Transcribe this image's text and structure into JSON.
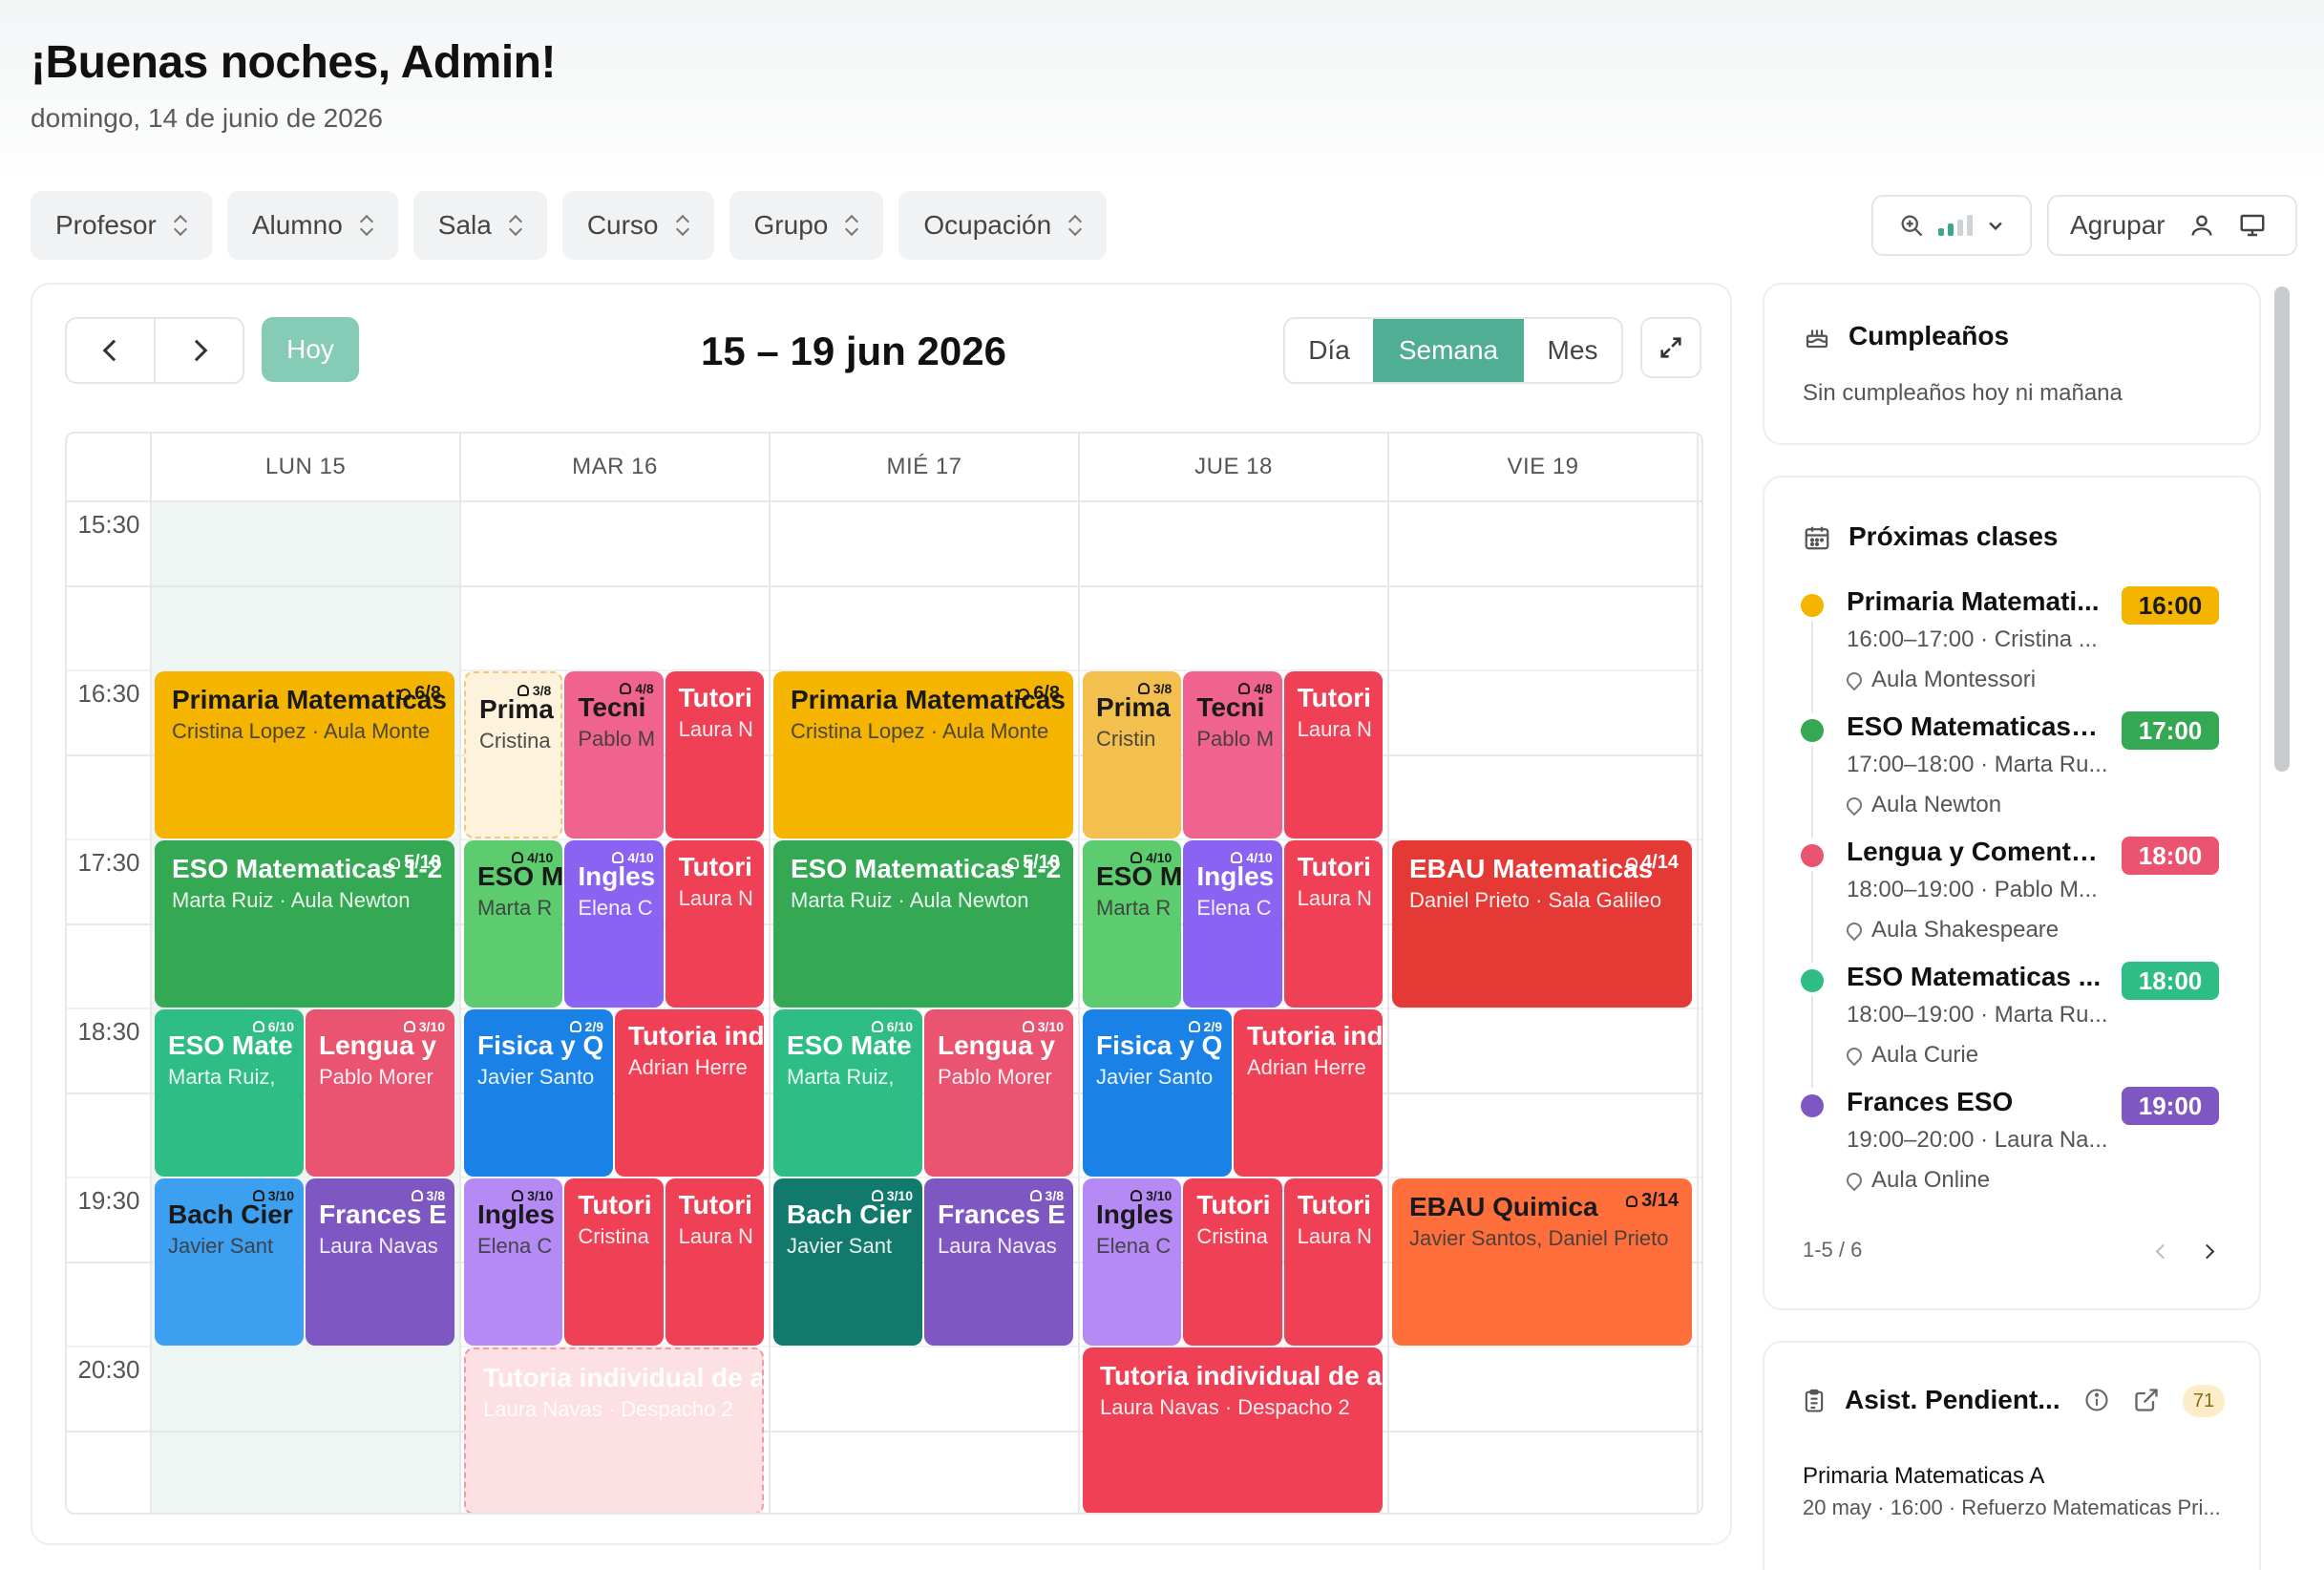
{
  "header": {
    "greeting": "¡Buenas noches, Admin!",
    "date": "domingo, 14 de junio de 2026"
  },
  "filters": [
    "Profesor",
    "Alumno",
    "Sala",
    "Curso",
    "Grupo",
    "Ocupación"
  ],
  "toolbar": {
    "group_label": "Agrupar",
    "zoom_icon": "zoom-in-icon"
  },
  "calendar": {
    "today_label": "Hoy",
    "range_title": "15 – 19 jun 2026",
    "views": [
      "Día",
      "Semana",
      "Mes"
    ],
    "active_view": "Semana",
    "days": [
      "LUN 15",
      "MAR 16",
      "MIÉ 17",
      "JUE 18",
      "VIE 19"
    ],
    "times": [
      "15:30",
      "16:30",
      "17:30",
      "18:30",
      "19:30",
      "20:30"
    ],
    "colors": {
      "amber": "#f4b400",
      "green": "#34a853",
      "teal": "#2fbd86",
      "rose": "#ea5470",
      "blue": "#3d9ff0",
      "purple": "#7e57c2",
      "red": "#ef4056",
      "pink": "#f0638f",
      "lightgreen": "#5ccc6e",
      "violet": "#8b63f2",
      "royal": "#1a82e6",
      "darkteal": "#127a6d",
      "lavender": "#b58af5",
      "crimson": "#e53935",
      "orange": "#ff6f3c"
    },
    "events": [
      {
        "day": 0,
        "start": 16.0,
        "end": 17.0,
        "col": 0,
        "cols": 1,
        "title": "Primaria Matematicas",
        "sub": "Cristina Lopez · Aula Monte",
        "badge": "6/8",
        "color": "amber",
        "dark": true
      },
      {
        "day": 0,
        "start": 17.0,
        "end": 18.0,
        "col": 0,
        "cols": 1,
        "title": "ESO Matematicas 1-2",
        "sub": "Marta Ruiz · Aula Newton",
        "badge": "5/10",
        "color": "green"
      },
      {
        "day": 0,
        "start": 18.0,
        "end": 19.0,
        "col": 0,
        "cols": 2,
        "title": "ESO Mate",
        "sub": "Marta Ruiz,",
        "badge": "6/10",
        "color": "teal",
        "narrow": true
      },
      {
        "day": 0,
        "start": 18.0,
        "end": 19.0,
        "col": 1,
        "cols": 2,
        "title": "Lengua y",
        "sub": "Pablo Morer",
        "badge": "3/10",
        "color": "rose",
        "narrow": true
      },
      {
        "day": 0,
        "start": 19.0,
        "end": 20.0,
        "col": 0,
        "cols": 2,
        "title": "Bach Cier",
        "sub": "Javier Sant",
        "badge": "3/10",
        "color": "blue",
        "narrow": true,
        "dark": true
      },
      {
        "day": 0,
        "start": 19.0,
        "end": 20.0,
        "col": 1,
        "cols": 2,
        "title": "Frances E",
        "sub": "Laura Navas",
        "badge": "3/8",
        "color": "purple",
        "narrow": true
      },
      {
        "day": 1,
        "start": 16.0,
        "end": 17.0,
        "col": 0,
        "cols": 3,
        "title": "Prima",
        "sub": "Cristina",
        "badge": "3/8",
        "color": "cream",
        "narrow": true,
        "dark": true,
        "ghost_amber": true
      },
      {
        "day": 1,
        "start": 16.0,
        "end": 17.0,
        "col": 1,
        "cols": 3,
        "title": "Tecni",
        "sub": "Pablo M",
        "badge": "4/8",
        "color": "pink",
        "narrow": true,
        "dark": true
      },
      {
        "day": 1,
        "start": 16.0,
        "end": 17.0,
        "col": 2,
        "cols": 3,
        "title": "Tutori",
        "sub": "Laura N",
        "badge": "",
        "color": "red",
        "narrow": true
      },
      {
        "day": 1,
        "start": 17.0,
        "end": 18.0,
        "col": 0,
        "cols": 3,
        "title": "ESO M",
        "sub": "Marta R",
        "badge": "4/10",
        "color": "lightgreen",
        "narrow": true,
        "dark": true
      },
      {
        "day": 1,
        "start": 17.0,
        "end": 18.0,
        "col": 1,
        "cols": 3,
        "title": "Ingles",
        "sub": "Elena C",
        "badge": "4/10",
        "color": "violet",
        "narrow": true
      },
      {
        "day": 1,
        "start": 17.0,
        "end": 18.0,
        "col": 2,
        "cols": 3,
        "title": "Tutori",
        "sub": "Laura N",
        "badge": "",
        "color": "red",
        "narrow": true
      },
      {
        "day": 1,
        "start": 18.0,
        "end": 19.0,
        "col": 0,
        "cols": 2,
        "title": "Fisica y Q",
        "sub": "Javier Santo",
        "badge": "2/9",
        "color": "royal",
        "narrow": true
      },
      {
        "day": 1,
        "start": 18.0,
        "end": 19.0,
        "col": 1,
        "cols": 2,
        "title": "Tutoria ind",
        "sub": "Adrian Herre",
        "badge": "",
        "color": "red",
        "narrow": true
      },
      {
        "day": 1,
        "start": 19.0,
        "end": 20.0,
        "col": 0,
        "cols": 3,
        "title": "Ingles",
        "sub": "Elena C",
        "badge": "3/10",
        "color": "lavender",
        "narrow": true,
        "dark": true
      },
      {
        "day": 1,
        "start": 19.0,
        "end": 20.0,
        "col": 1,
        "cols": 3,
        "title": "Tutori",
        "sub": "Cristina",
        "badge": "",
        "color": "red",
        "narrow": true
      },
      {
        "day": 1,
        "start": 19.0,
        "end": 20.0,
        "col": 2,
        "cols": 3,
        "title": "Tutori",
        "sub": "Laura N",
        "badge": "",
        "color": "red",
        "narrow": true
      },
      {
        "day": 1,
        "start": 20.0,
        "end": 21.0,
        "col": 0,
        "cols": 1,
        "title": "Tutoria individual de ap",
        "sub": "Laura Navas · Despacho 2",
        "badge": "",
        "color": "ghostred",
        "ghost": true
      },
      {
        "day": 2,
        "start": 16.0,
        "end": 17.0,
        "col": 0,
        "cols": 1,
        "title": "Primaria Matematicas",
        "sub": "Cristina Lopez · Aula Monte",
        "badge": "6/8",
        "color": "amber",
        "dark": true
      },
      {
        "day": 2,
        "start": 17.0,
        "end": 18.0,
        "col": 0,
        "cols": 1,
        "title": "ESO Matematicas 1-2",
        "sub": "Marta Ruiz · Aula Newton",
        "badge": "5/10",
        "color": "green"
      },
      {
        "day": 2,
        "start": 18.0,
        "end": 19.0,
        "col": 0,
        "cols": 2,
        "title": "ESO Mate",
        "sub": "Marta Ruiz,",
        "badge": "6/10",
        "color": "teal",
        "narrow": true
      },
      {
        "day": 2,
        "start": 18.0,
        "end": 19.0,
        "col": 1,
        "cols": 2,
        "title": "Lengua y",
        "sub": "Pablo Morer",
        "badge": "3/10",
        "color": "rose",
        "narrow": true
      },
      {
        "day": 2,
        "start": 19.0,
        "end": 20.0,
        "col": 0,
        "cols": 2,
        "title": "Bach Cier",
        "sub": "Javier Sant",
        "badge": "3/10",
        "color": "darkteal",
        "narrow": true
      },
      {
        "day": 2,
        "start": 19.0,
        "end": 20.0,
        "col": 1,
        "cols": 2,
        "title": "Frances E",
        "sub": "Laura Navas",
        "badge": "3/8",
        "color": "purple",
        "narrow": true
      },
      {
        "day": 3,
        "start": 16.0,
        "end": 17.0,
        "col": 0,
        "cols": 3,
        "title": "Prima",
        "sub": "Cristin",
        "badge": "3/8",
        "color": "gold",
        "narrow": true,
        "dark": true
      },
      {
        "day": 3,
        "start": 16.0,
        "end": 17.0,
        "col": 1,
        "cols": 3,
        "title": "Tecni",
        "sub": "Pablo M",
        "badge": "4/8",
        "color": "pink",
        "narrow": true,
        "dark": true
      },
      {
        "day": 3,
        "start": 16.0,
        "end": 17.0,
        "col": 2,
        "cols": 3,
        "title": "Tutori",
        "sub": "Laura N",
        "badge": "",
        "color": "red",
        "narrow": true
      },
      {
        "day": 3,
        "start": 17.0,
        "end": 18.0,
        "col": 0,
        "cols": 3,
        "title": "ESO M",
        "sub": "Marta R",
        "badge": "4/10",
        "color": "lightgreen",
        "narrow": true,
        "dark": true
      },
      {
        "day": 3,
        "start": 17.0,
        "end": 18.0,
        "col": 1,
        "cols": 3,
        "title": "Ingles",
        "sub": "Elena C",
        "badge": "4/10",
        "color": "violet",
        "narrow": true
      },
      {
        "day": 3,
        "start": 17.0,
        "end": 18.0,
        "col": 2,
        "cols": 3,
        "title": "Tutori",
        "sub": "Laura N",
        "badge": "",
        "color": "red",
        "narrow": true
      },
      {
        "day": 3,
        "start": 18.0,
        "end": 19.0,
        "col": 0,
        "cols": 2,
        "title": "Fisica y Q",
        "sub": "Javier Santo",
        "badge": "2/9",
        "color": "royal",
        "narrow": true
      },
      {
        "day": 3,
        "start": 18.0,
        "end": 19.0,
        "col": 1,
        "cols": 2,
        "title": "Tutoria ind",
        "sub": "Adrian Herre",
        "badge": "",
        "color": "red",
        "narrow": true
      },
      {
        "day": 3,
        "start": 19.0,
        "end": 20.0,
        "col": 0,
        "cols": 3,
        "title": "Ingles",
        "sub": "Elena C",
        "badge": "3/10",
        "color": "lavender",
        "narrow": true,
        "dark": true
      },
      {
        "day": 3,
        "start": 19.0,
        "end": 20.0,
        "col": 1,
        "cols": 3,
        "title": "Tutori",
        "sub": "Cristina",
        "badge": "",
        "color": "red",
        "narrow": true
      },
      {
        "day": 3,
        "start": 19.0,
        "end": 20.0,
        "col": 2,
        "cols": 3,
        "title": "Tutori",
        "sub": "Laura N",
        "badge": "",
        "color": "red",
        "narrow": true
      },
      {
        "day": 3,
        "start": 20.0,
        "end": 21.0,
        "col": 0,
        "cols": 1,
        "title": "Tutoria individual de ap",
        "sub": "Laura Navas · Despacho 2",
        "badge": "",
        "color": "red"
      },
      {
        "day": 4,
        "start": 17.0,
        "end": 18.0,
        "col": 0,
        "cols": 1,
        "title": "EBAU Matematicas",
        "sub": "Daniel Prieto · Sala Galileo",
        "badge": "4/14",
        "color": "crimson"
      },
      {
        "day": 4,
        "start": 19.0,
        "end": 20.0,
        "col": 0,
        "cols": 1,
        "title": "EBAU Quimica",
        "sub": "Javier Santos, Daniel Prieto",
        "badge": "3/14",
        "color": "orange",
        "dark": true
      }
    ]
  },
  "sidebar": {
    "birthdays": {
      "title": "Cumpleaños",
      "empty": "Sin cumpleaños hoy ni mañana"
    },
    "upcoming": {
      "title": "Próximas clases",
      "items": [
        {
          "name": "Primaria Matemati...",
          "when": "16:00–17:00 · Cristina ...",
          "room": "Aula Montessori",
          "time": "16:00",
          "color": "#f4b400",
          "text": "#1a1a1a"
        },
        {
          "name": "ESO Matematicas 1...",
          "when": "17:00–18:00 · Marta Ru...",
          "room": "Aula Newton",
          "time": "17:00",
          "color": "#34a853",
          "text": "#ffffff"
        },
        {
          "name": "Lengua y Comenta...",
          "when": "18:00–19:00 · Pablo M...",
          "room": "Aula Shakespeare",
          "time": "18:00",
          "color": "#ea5470",
          "text": "#ffffff"
        },
        {
          "name": "ESO Matematicas ...",
          "when": "18:00–19:00 · Marta Ru...",
          "room": "Aula Curie",
          "time": "18:00",
          "color": "#2fbd86",
          "text": "#ffffff"
        },
        {
          "name": "Frances ESO",
          "when": "19:00–20:00 · Laura Na...",
          "room": "Aula Online",
          "time": "19:00",
          "color": "#7e57c2",
          "text": "#ffffff"
        }
      ],
      "pagination": "1-5 / 6"
    },
    "attendance": {
      "title": "Asist. Pendient...",
      "count": "71",
      "item_title": "Primaria Matematicas A",
      "item_sub": "20 may · 16:00 · Refuerzo Matematicas Pri..."
    }
  }
}
